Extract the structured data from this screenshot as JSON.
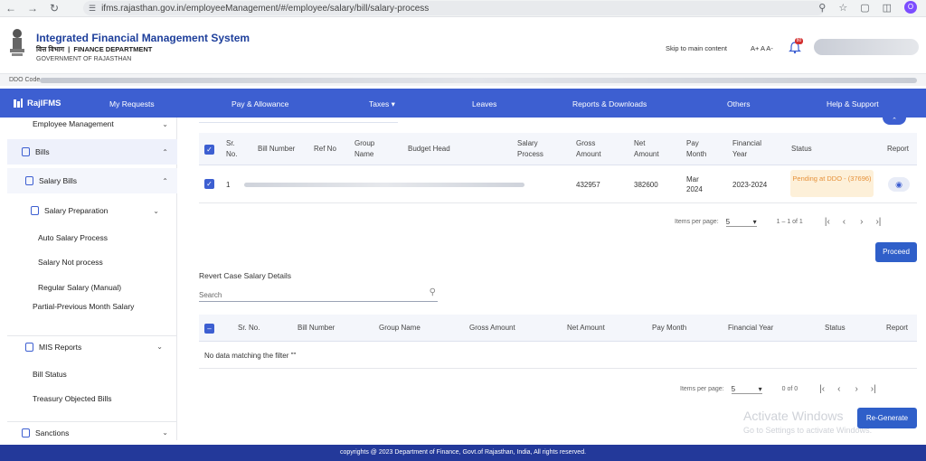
{
  "browser": {
    "url": "ifms.rajasthan.gov.in/employeeManagement/#/employee/salary/bill/salary-process",
    "profile_initial": "O"
  },
  "header": {
    "title": "Integrated Financial Management System",
    "subtitle_hindi": "वित्त विभाग",
    "subtitle_dept": "FINANCE DEPARTMENT",
    "gov": "GOVERNMENT OF RAJASTHAN",
    "skip_link": "Skip to main content",
    "font_controls": "A+  A  A-",
    "notification_count": "80"
  },
  "ddo": {
    "label": "DDO Code"
  },
  "nav": {
    "brand": "RajIFMS",
    "items": [
      "My Requests",
      "Pay & Allowance",
      "Taxes ▾",
      "Leaves",
      "Reports & Downloads",
      "Others",
      "Help & Support"
    ]
  },
  "sidebar": {
    "employee_management": "Employee Management",
    "bills": "Bills",
    "salary_bills": "Salary Bills",
    "salary_preparation": "Salary Preparation",
    "auto_salary_process": "Auto Salary Process",
    "salary_not_process": "Salary Not process",
    "regular_salary": "Regular Salary (Manual)",
    "partial_previous": "Partial-Previous Month Salary",
    "mis_reports": "MIS Reports",
    "bill_status": "Bill Status",
    "treasury_objected": "Treasury Objected Bills",
    "sanctions": "Sanctions"
  },
  "salary_table": {
    "headers": {
      "sr_no": "Sr. No.",
      "bill_number": "Bill Number",
      "ref_no": "Ref No",
      "group_name": "Group Name",
      "budget_head": "Budget Head",
      "salary_process": "Salary Process",
      "gross_amount": "Gross Amount",
      "net_amount": "Net Amount",
      "pay_month": "Pay Month",
      "financial_year": "Financial Year",
      "status": "Status",
      "report": "Report"
    },
    "row": {
      "sr_no": "1",
      "gross_amount": "432957",
      "net_amount": "382600",
      "pay_month": "Mar 2024",
      "financial_year": "2023-2024",
      "status": "Pending at DDO - (37696)"
    },
    "pager": {
      "items_per_page_label": "Items per page:",
      "items_per_page": "5",
      "range": "1 – 1 of 1"
    }
  },
  "proceed_button": "Proceed",
  "revert": {
    "title": "Revert Case Salary Details",
    "search_placeholder": "Search",
    "headers": {
      "sr_no": "Sr. No.",
      "bill_number": "Bill Number",
      "group_name": "Group Name",
      "gross_amount": "Gross Amount",
      "net_amount": "Net Amount",
      "pay_month": "Pay Month",
      "financial_year": "Financial Year",
      "status": "Status",
      "report": "Report"
    },
    "empty_message": "No data matching the filter \"\"",
    "pager": {
      "items_per_page_label": "Items per page:",
      "items_per_page": "5",
      "range": "0 of 0"
    }
  },
  "regenerate_button": "Re-Generate",
  "watermark": {
    "line1": "Activate Windows",
    "line2": "Go to Settings to activate Windows."
  },
  "footer": "copyrights @ 2023 Department of Finance, Govt.of Rajasthan, India, All rights reserved."
}
